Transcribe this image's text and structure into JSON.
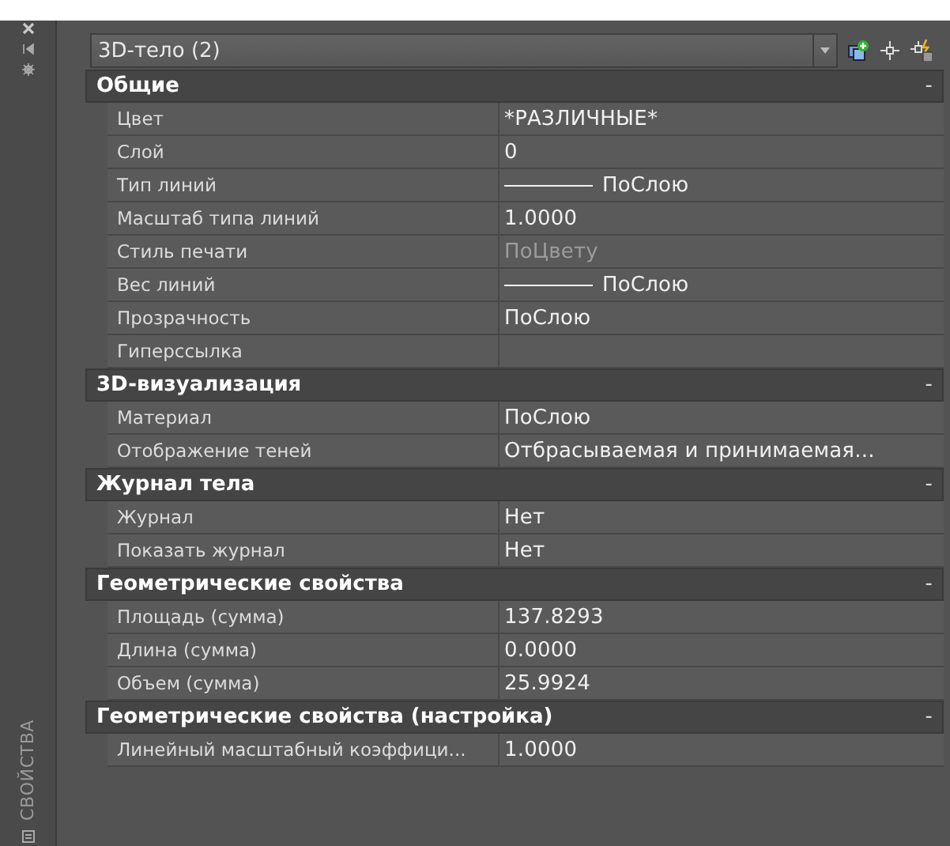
{
  "palette_tab": {
    "label": "СВОЙСТВА"
  },
  "selector": {
    "value": "3D-тело (2)"
  },
  "sections": [
    {
      "title": "Общие",
      "toggle": "-",
      "rows": [
        {
          "label": "Цвет",
          "value": "*РАЗЛИЧНЫЕ*",
          "kind": "text",
          "disabled": false
        },
        {
          "label": "Слой",
          "value": "0",
          "kind": "text",
          "disabled": false
        },
        {
          "label": "Тип линий",
          "value": "ПоСлою",
          "kind": "line",
          "disabled": false
        },
        {
          "label": "Масштаб типа линий",
          "value": "1.0000",
          "kind": "text",
          "disabled": false
        },
        {
          "label": "Стиль печати",
          "value": "ПоЦвету",
          "kind": "text",
          "disabled": true
        },
        {
          "label": "Вес линий",
          "value": "ПоСлою",
          "kind": "line",
          "disabled": false
        },
        {
          "label": "Прозрачность",
          "value": "ПоСлою",
          "kind": "text",
          "disabled": false
        },
        {
          "label": "Гиперссылка",
          "kind": "text"
        }
      ]
    },
    {
      "title": "3D-визуализация",
      "toggle": "-",
      "rows": [
        {
          "label": "Материал",
          "value": "ПоСлою",
          "kind": "text",
          "disabled": false
        },
        {
          "label": "Отображение теней",
          "value": "Отбрасываемая и принимаемая...",
          "kind": "text",
          "disabled": false
        }
      ]
    },
    {
      "title": "Журнал тела",
      "toggle": "-",
      "rows": [
        {
          "label": "Журнал",
          "value": "Нет",
          "kind": "text",
          "disabled": false
        },
        {
          "label": "Показать журнал",
          "value": "Нет",
          "kind": "text",
          "disabled": false
        }
      ]
    },
    {
      "title": "Геометрические свойства",
      "toggle": "-",
      "rows": [
        {
          "label": "Площадь (сумма)",
          "value": "137.8293",
          "kind": "text",
          "disabled": false
        },
        {
          "label": "Длина (сумма)",
          "value": "0.0000",
          "kind": "text",
          "disabled": false
        },
        {
          "label": "Объем (сумма)",
          "value": "25.9924",
          "kind": "text",
          "disabled": false
        }
      ]
    },
    {
      "title": "Геометрические свойства (настройка)",
      "toggle": "-",
      "rows": [
        {
          "label": "Линейный масштабный коэффици...",
          "value": "1.0000",
          "kind": "text",
          "disabled": false
        }
      ]
    }
  ]
}
